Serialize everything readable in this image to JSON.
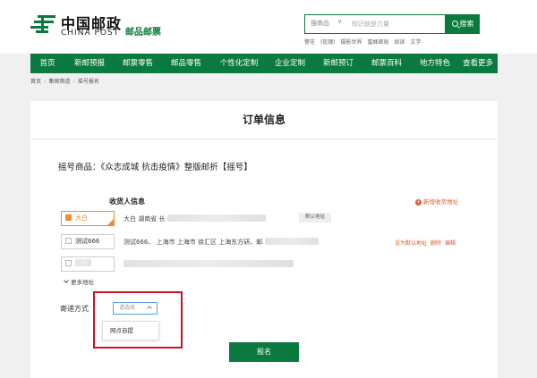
{
  "header": {
    "logo_cn": "中国邮政",
    "logo_en": "CHINA POST",
    "logo_sub": "邮品邮票",
    "search": {
      "category": "搜商品",
      "placeholder": "知识就是力量",
      "button_label": "搜索"
    },
    "hot_words": [
      "警花",
      "(玫瑰)",
      "摄影世界",
      "蜜蜂邮局",
      "阅读",
      "文学"
    ]
  },
  "nav": {
    "items": [
      "首页",
      "新邮预报",
      "邮票零售",
      "邮品零售",
      "个性化定制",
      "企业定制",
      "新邮预订",
      "邮票百科",
      "地方特色",
      "查看更多"
    ]
  },
  "breadcrumb": [
    "首页",
    "集邮频道",
    "摇号报名"
  ],
  "order": {
    "title": "订单信息",
    "product_label": "摇号商品：",
    "product_name": "《众志成城 抗击疫情》整版邮折【摇号】",
    "receiver_title": "收货人信息",
    "new_address_label": "新增收货地址",
    "addresses": [
      {
        "tag": "大白",
        "line_start": "大白    湖南省 长",
        "default_label": "默认地址"
      },
      {
        "tag": "测试666",
        "line_start": "测试666、    上海市 上海市 徐汇区 上海东方研、邮"
      },
      {
        "tag": ""
      }
    ],
    "address_actions": [
      "设为默认地址",
      "删除",
      "编辑"
    ],
    "more_addresses": "更多地址",
    "shipping_label": "寄递方式",
    "shipping_placeholder": "请选择",
    "shipping_option": "网点自提",
    "submit_label": "报名"
  },
  "colors": {
    "brand_green": "#0b7a3e",
    "accent_orange": "#f08c2a",
    "link_red": "#e2582e",
    "highlight_red": "#c8102e"
  }
}
